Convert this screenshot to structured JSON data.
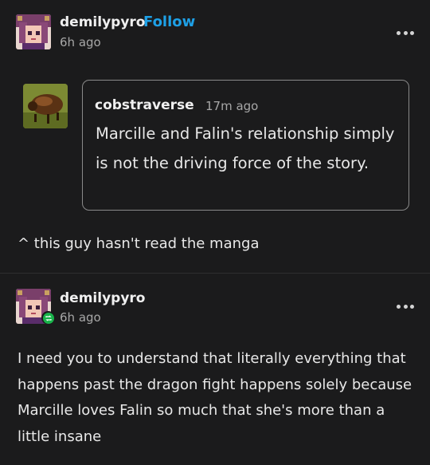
{
  "post1": {
    "username": "demilypyro",
    "follow_label": "Follow",
    "time": "6h ago",
    "more_icon": "more-horizontal-icon"
  },
  "quote": {
    "username": "cobstraverse",
    "time": "17m ago",
    "text": "Marcille and Falin's relationship simply is not the driving force of the story."
  },
  "post1_comment": "^ this guy hasn't read the manga",
  "post2": {
    "username": "demilypyro",
    "time": "6h ago",
    "badge_icon": "reblog-icon",
    "badge_color": "#19b34a",
    "more_icon": "more-horizontal-icon",
    "text": "I need you to understand that literally everything that happens past the dragon fight happens solely because Marcille loves Falin so much that she's more than a little insane"
  },
  "colors": {
    "background": "#1b1b1c",
    "follow": "#1ea0e6"
  }
}
